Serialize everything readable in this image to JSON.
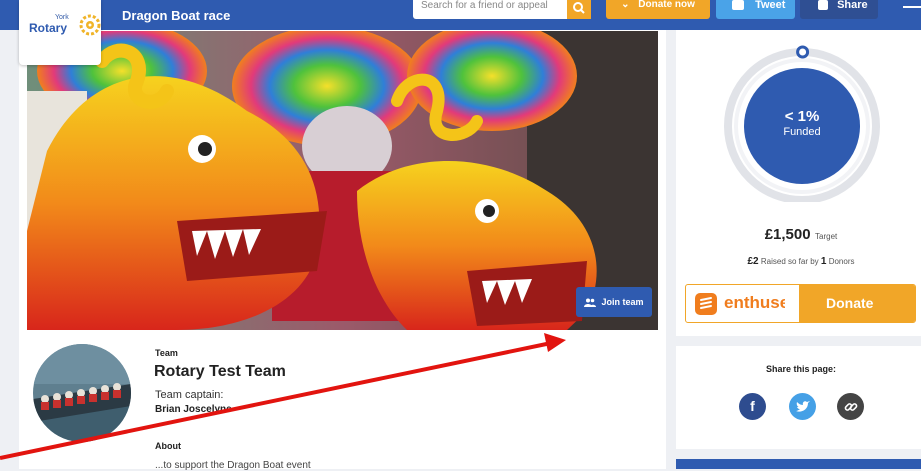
{
  "header": {
    "logo_small": "York",
    "logo_main": "Rotary",
    "title": "Dragon Boat race",
    "search_placeholder": "Search for a friend or appeal",
    "donate_now": "Donate now",
    "tweet": "Tweet",
    "share": "Share"
  },
  "hero": {
    "join_team": "Join team"
  },
  "team": {
    "label": "Team",
    "name": "Rotary Test Team",
    "captain_label": "Team captain:",
    "captain_name": "Brian Joscelyne",
    "about_label": "About",
    "about_text": "...to support the Dragon Boat event"
  },
  "funding": {
    "percent": "< 1%",
    "funded_label": "Funded",
    "target_amount": "£1,500",
    "target_label": "Target",
    "raised_amount": "£2",
    "raised_text": "Raised so far by",
    "donor_count": "1",
    "donors_label": "Donors",
    "progress_fraction": 0.0013
  },
  "donate": {
    "brand": "enthuse",
    "label": "Donate"
  },
  "share": {
    "title": "Share this page:",
    "icons": [
      "facebook-icon",
      "twitter-icon",
      "link-icon"
    ]
  },
  "colors": {
    "primary": "#2f5bb0",
    "accent": "#f1a628",
    "enthuse": "#f07d1e"
  }
}
